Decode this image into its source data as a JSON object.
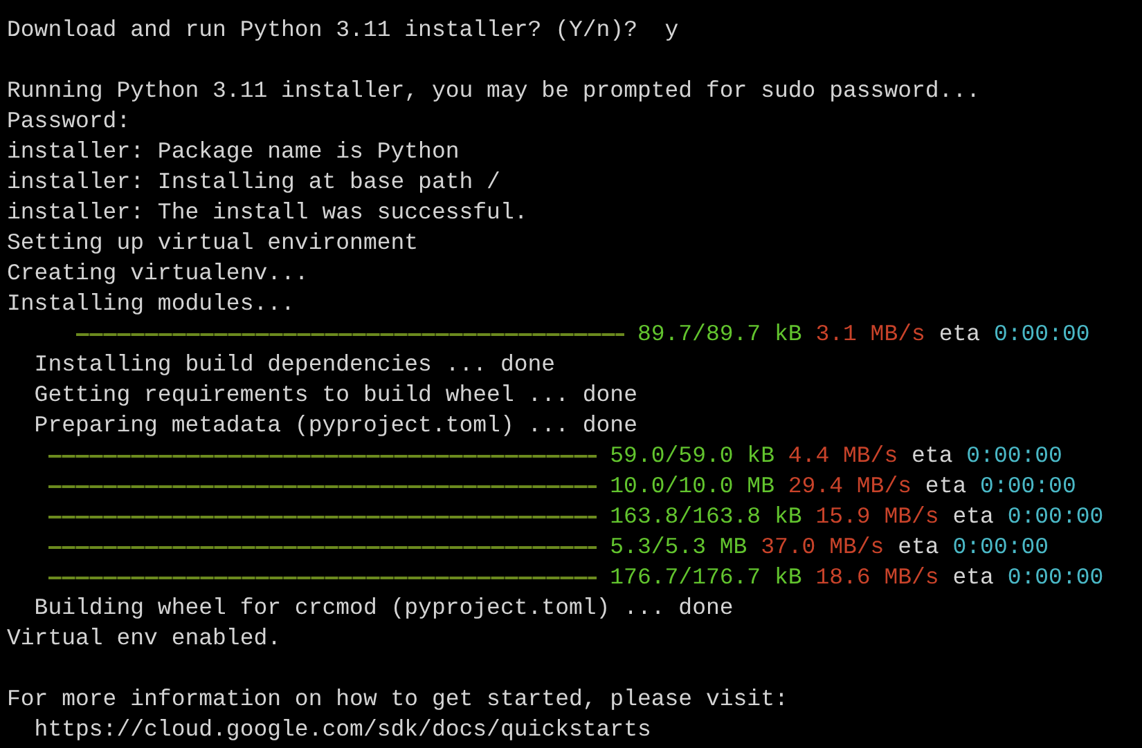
{
  "terminal": {
    "lines": [
      {
        "kind": "text",
        "text": "Download and run Python 3.11 installer? (Y/n)?  y"
      },
      {
        "kind": "blank"
      },
      {
        "kind": "text",
        "text": "Running Python 3.11 installer, you may be prompted for sudo password..."
      },
      {
        "kind": "text",
        "text": "Password:"
      },
      {
        "kind": "text",
        "text": "installer: Package name is Python"
      },
      {
        "kind": "text",
        "text": "installer: Installing at base path /"
      },
      {
        "kind": "text",
        "text": "installer: The install was successful."
      },
      {
        "kind": "text",
        "text": "Setting up virtual environment"
      },
      {
        "kind": "text",
        "text": "Creating virtualenv..."
      },
      {
        "kind": "text",
        "text": "Installing modules..."
      },
      {
        "kind": "progress",
        "level": 1,
        "size": "89.7/89.7 kB",
        "speed": "3.1 MB/s",
        "eta_label": "eta",
        "eta": "0:00:00"
      },
      {
        "kind": "text",
        "text": "  Installing build dependencies ... done"
      },
      {
        "kind": "text",
        "text": "  Getting requirements to build wheel ... done"
      },
      {
        "kind": "text",
        "text": "  Preparing metadata (pyproject.toml) ... done"
      },
      {
        "kind": "step_progress",
        "level": 1,
        "size": "59.0/59.0 kB",
        "speed": "4.4 MB/s",
        "eta_label": "eta",
        "eta": "0:00:00"
      },
      {
        "kind": "step_progress",
        "level": 1,
        "size": "10.0/10.0 MB",
        "speed": "29.4 MB/s",
        "eta_label": "eta",
        "eta": "0:00:00"
      },
      {
        "kind": "step_progress",
        "level": 1,
        "size": "163.8/163.8 kB",
        "speed": "15.9 MB/s",
        "eta_label": "eta",
        "eta": "0:00:00"
      },
      {
        "kind": "step_progress",
        "level": 1,
        "size": "5.3/5.3 MB",
        "speed": "37.0 MB/s",
        "eta_label": "eta",
        "eta": "0:00:00"
      },
      {
        "kind": "step_progress",
        "level": 1,
        "size": "176.7/176.7 kB",
        "speed": "18.6 MB/s",
        "eta_label": "eta",
        "eta": "0:00:00"
      },
      {
        "kind": "text",
        "text": "  Building wheel for crcmod (pyproject.toml) ... done"
      },
      {
        "kind": "text",
        "text": "Virtual env enabled."
      },
      {
        "kind": "blank"
      },
      {
        "kind": "text",
        "text": "For more information on how to get started, please visit:"
      },
      {
        "kind": "link",
        "text": "  https://cloud.google.com/sdk/docs/quickstarts"
      }
    ]
  }
}
